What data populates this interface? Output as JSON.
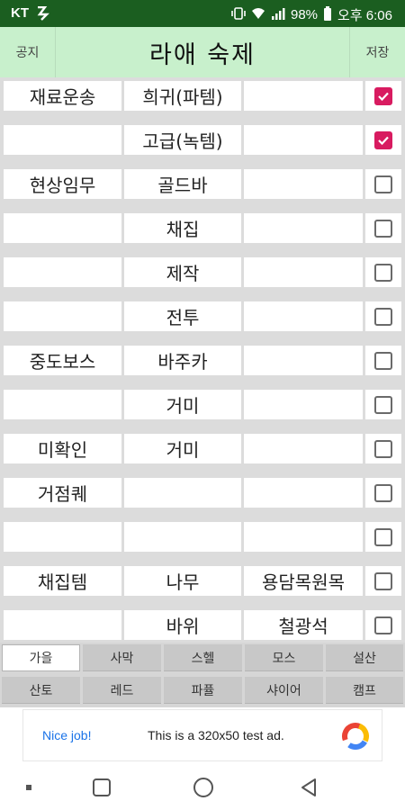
{
  "status_bar": {
    "carrier": "KT",
    "battery": "98%",
    "time": "오후 6:06"
  },
  "header": {
    "left_button": "공지",
    "title": "라애 숙제",
    "right_button": "저장"
  },
  "rows": [
    {
      "c1": "재료운송",
      "c2": "희귀(파템)",
      "c3": "",
      "checked": true
    },
    {
      "c1": "",
      "c2": "고급(녹템)",
      "c3": "",
      "checked": true
    },
    {
      "c1": "현상임무",
      "c2": "골드바",
      "c3": "",
      "checked": false
    },
    {
      "c1": "",
      "c2": "채집",
      "c3": "",
      "checked": false
    },
    {
      "c1": "",
      "c2": "제작",
      "c3": "",
      "checked": false
    },
    {
      "c1": "",
      "c2": "전투",
      "c3": "",
      "checked": false
    },
    {
      "c1": "중도보스",
      "c2": "바주카",
      "c3": "",
      "checked": false
    },
    {
      "c1": "",
      "c2": "거미",
      "c3": "",
      "checked": false
    },
    {
      "c1": "미확인",
      "c2": "거미",
      "c3": "",
      "checked": false
    },
    {
      "c1": "거점퀘",
      "c2": "",
      "c3": "",
      "checked": false
    },
    {
      "c1": "",
      "c2": "",
      "c3": "",
      "checked": false
    },
    {
      "c1": "채집템",
      "c2": "나무",
      "c3": "용담목원목",
      "checked": false
    },
    {
      "c1": "",
      "c2": "바위",
      "c3": "철광석",
      "checked": false
    }
  ],
  "tabs_row1": [
    "가을",
    "사막",
    "스헬",
    "모스",
    "설산"
  ],
  "tabs_row2": [
    "산토",
    "레드",
    "파퓰",
    "샤이어",
    "캠프"
  ],
  "active_tab": "가을",
  "ad": {
    "left": "Nice job!",
    "text": "This is a 320x50 test ad."
  },
  "colors": {
    "status_bar": "#1b5e20",
    "header": "#c8f0cc",
    "checkbox": "#d81b60",
    "ad_link": "#1a73e8"
  }
}
